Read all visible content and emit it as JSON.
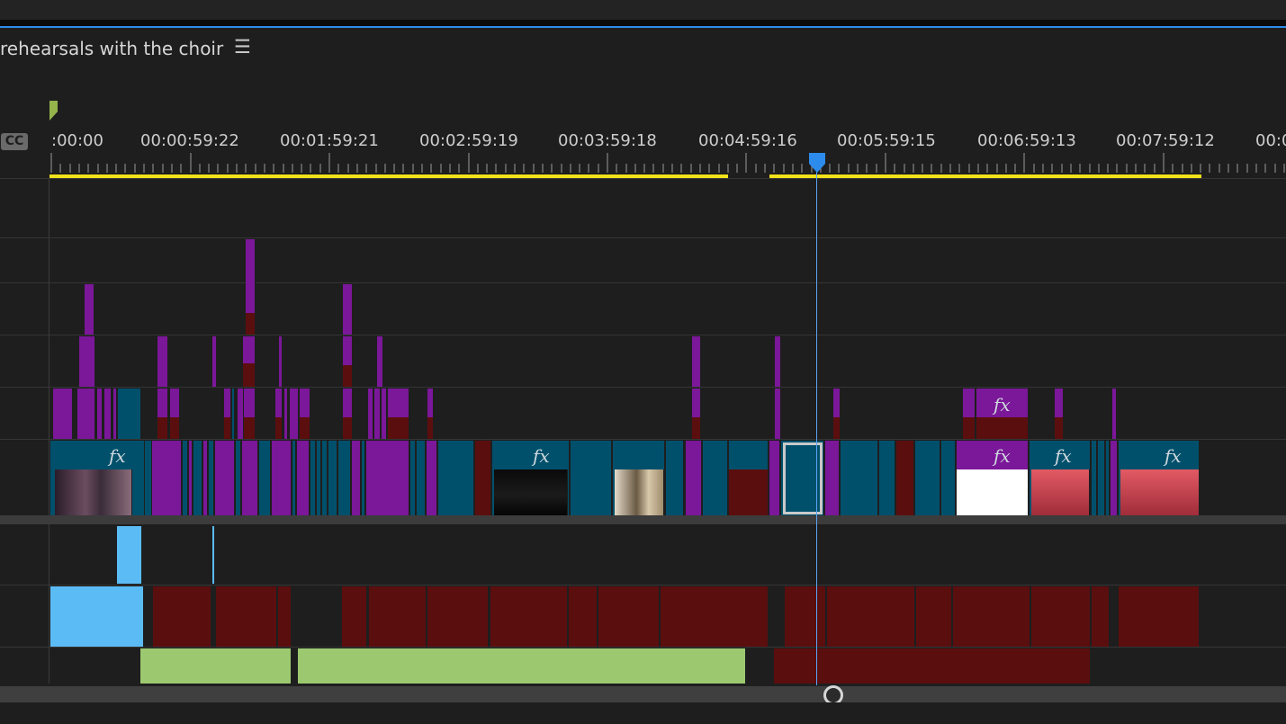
{
  "sequence": {
    "title": "rehearsals with the choir",
    "menu_icon": "hamburger-menu-icon"
  },
  "ruler": {
    "captions_label": "CC",
    "timecodes": [
      ":00:00",
      "00:00:59:22",
      "00:01:59:21",
      "00:02:59:19",
      "00:03:59:18",
      "00:04:59:16",
      "00:05:59:15",
      "00:06:59:13",
      "00:07:59:12",
      "00:0"
    ]
  },
  "effects": {
    "fx_label": "fx"
  },
  "colors": {
    "video_clip": "#00506c",
    "adjustment_clip": "#7b1799",
    "offline_clip": "#5b0e0e",
    "audio_clip_blue": "#5bbcf5",
    "audio_clip_green": "#9cc970",
    "work_area": "#f0e11b",
    "playhead": "#2d8ceb"
  }
}
